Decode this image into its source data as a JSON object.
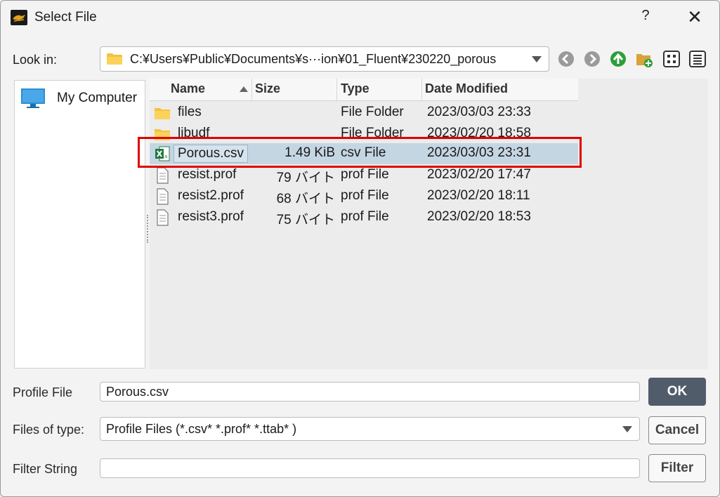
{
  "window": {
    "title": "Select File",
    "help_label": "?",
    "close_label": "✕"
  },
  "lookin": {
    "label": "Look in:",
    "path": "C:¥Users¥Public¥Documents¥s···ion¥01_Fluent¥230220_porous"
  },
  "sidebar": {
    "items": [
      {
        "label": "My Computer",
        "icon": "computer-icon"
      }
    ]
  },
  "file_list": {
    "columns": {
      "name": "Name",
      "size": "Size",
      "type": "Type",
      "date": "Date Modified"
    },
    "sort": {
      "column": "Name",
      "direction": "ascending"
    },
    "rows": [
      {
        "name": "files",
        "size": "",
        "type": "File Folder",
        "date": "2023/03/03 23:33",
        "icon": "folder-icon"
      },
      {
        "name": "libudf",
        "size": "",
        "type": "File Folder",
        "date": "2023/02/20 18:58",
        "icon": "folder-icon"
      },
      {
        "name": "Porous.csv",
        "size": "1.49 KiB",
        "type": "csv File",
        "date": "2023/03/03 23:31",
        "icon": "excel-csv-icon",
        "selected": true
      },
      {
        "name": "resist.prof",
        "size": "79 バイト",
        "type": "prof File",
        "date": "2023/02/20 17:47",
        "icon": "document-icon"
      },
      {
        "name": "resist2.prof",
        "size": "68 バイト",
        "type": "prof File",
        "date": "2023/02/20 18:11",
        "icon": "document-icon"
      },
      {
        "name": "resist3.prof",
        "size": "75 バイト",
        "type": "prof File",
        "date": "2023/02/20 18:53",
        "icon": "document-icon"
      }
    ]
  },
  "form": {
    "profile_file_label": "Profile File",
    "profile_file_value": "Porous.csv",
    "files_of_type_label": "Files of type:",
    "files_of_type_value": "Profile Files (*.csv* *.prof* *.ttab* )",
    "filter_string_label": "Filter String",
    "filter_string_value": ""
  },
  "buttons": {
    "ok": "OK",
    "cancel": "Cancel",
    "filter": "Filter"
  },
  "colors": {
    "selection": "#c5d6e3",
    "highlight": "#e00000",
    "ok_button": "#515c6b"
  }
}
